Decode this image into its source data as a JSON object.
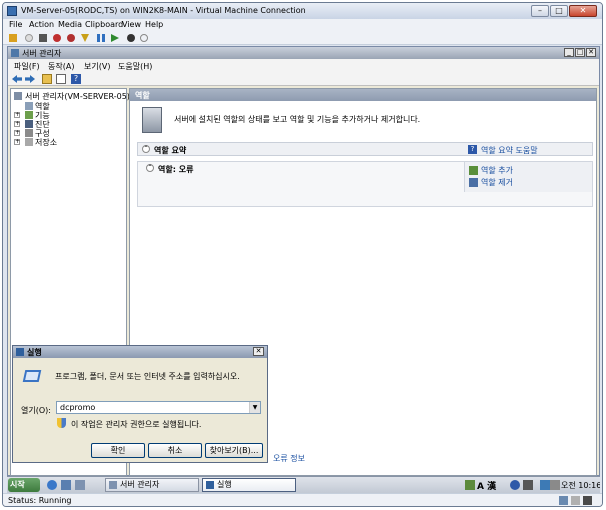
{
  "vm_window": {
    "title": "VM-Server-05(RODC,TS) on WIN2K8-MAIN - Virtual Machine Connection",
    "menu": [
      "File",
      "Action",
      "Media",
      "Clipboard",
      "View",
      "Help"
    ],
    "status": "Status: Running"
  },
  "server_manager": {
    "title": "서버 관리자",
    "menu": [
      "파일(F)",
      "동작(A)",
      "보기(V)",
      "도움말(H)"
    ],
    "tree": {
      "root": "서버 관리자(VM-SERVER-05)",
      "items": [
        "역할",
        "기능",
        "진단",
        "구성",
        "저장소"
      ]
    },
    "content": {
      "header": "역할",
      "banner_text": "서버에 설치된 역할의 상태를 보고 역할 및 기능을 추가하거나 제거합니다.",
      "summary_title": "역할 요약",
      "summary_help": "역할 요약 도움말",
      "roles_title": "역할: 오류",
      "actions": [
        "역할 추가",
        "역할 제거"
      ],
      "error_link": "오류 정보"
    }
  },
  "run_dialog": {
    "title": "실행",
    "description": "프로그램, 폴더, 문서 또는 인터넷 주소를 입력하십시오.",
    "open_label": "열기(O):",
    "open_value": "dcpromo",
    "admin_note": "이 작업은 관리자 권한으로 실행됩니다.",
    "buttons": {
      "ok": "확인",
      "cancel": "취소",
      "browse": "찾아보기(B)..."
    }
  },
  "taskbar": {
    "start": "시작",
    "tasks": [
      "서버 관리자",
      "실행"
    ],
    "ime": "A 漢",
    "clock": "오전 10:16"
  },
  "colors": {
    "desktop": "#3b6ea5",
    "link": "#1a4fa0",
    "vm_status_green": "#2f8a2f"
  }
}
